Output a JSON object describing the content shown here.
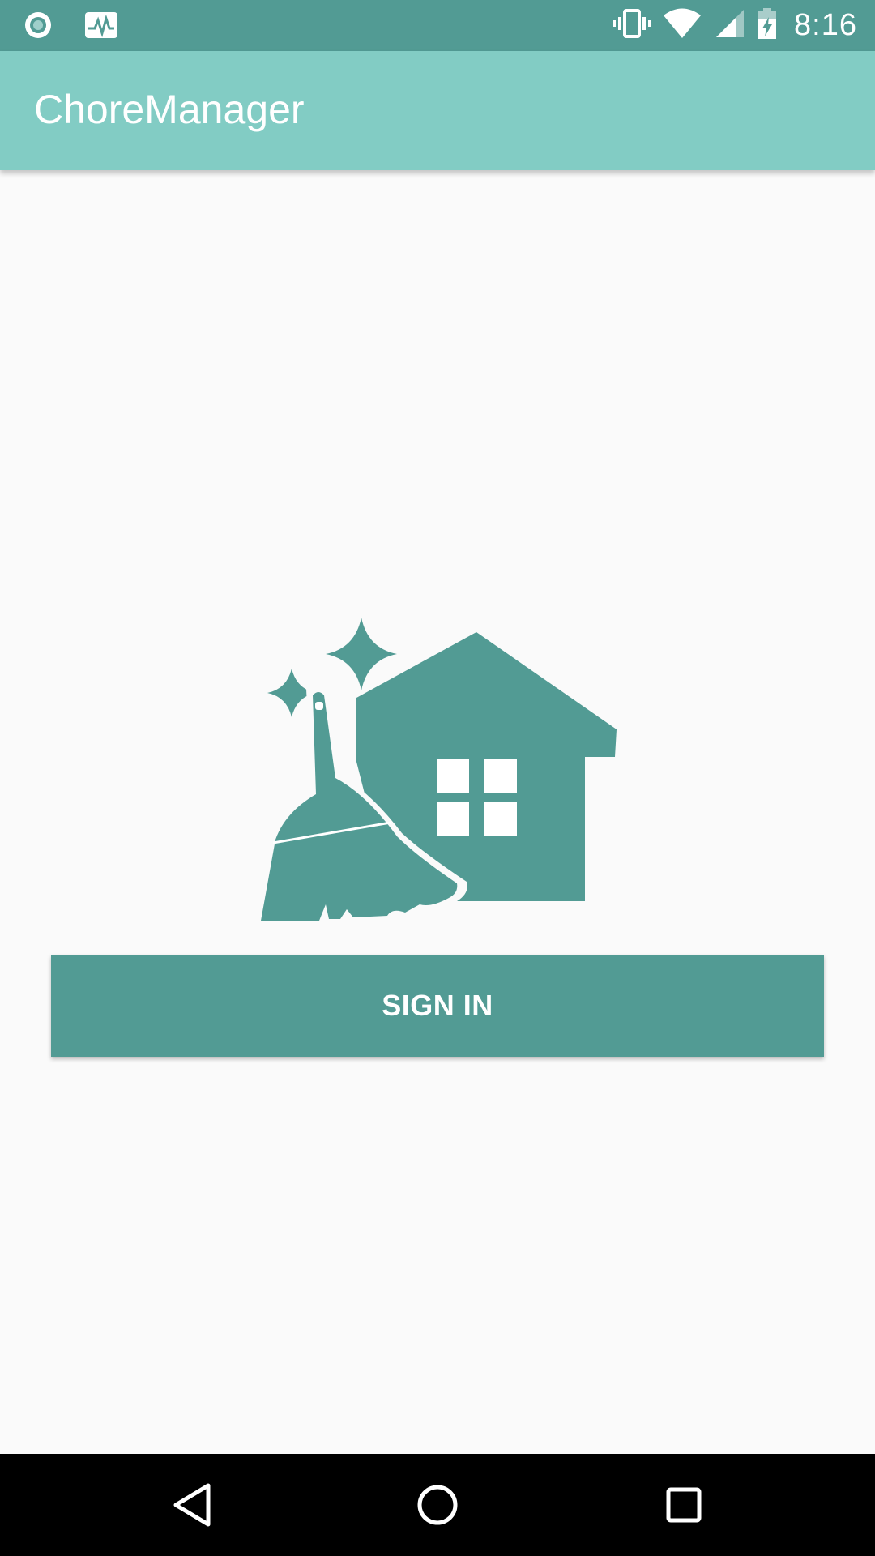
{
  "status_bar": {
    "time": "8:16",
    "left_icons": [
      "record-indicator-icon",
      "activity-monitor-icon"
    ],
    "right_icons": [
      "vibrate-icon",
      "wifi-icon",
      "cell-signal-icon",
      "battery-charging-icon"
    ]
  },
  "app_bar": {
    "title": "ChoreManager"
  },
  "main": {
    "logo_icon": "broom-house-icon",
    "sign_in_label": "SIGN IN"
  },
  "nav_bar": {
    "icons": [
      "back-icon",
      "home-icon",
      "recents-icon"
    ]
  },
  "colors": {
    "status_bar": "#529b94",
    "app_bar": "#82ccc4",
    "accent": "#529b94",
    "background": "#fafafa",
    "nav_bar": "#000000"
  }
}
